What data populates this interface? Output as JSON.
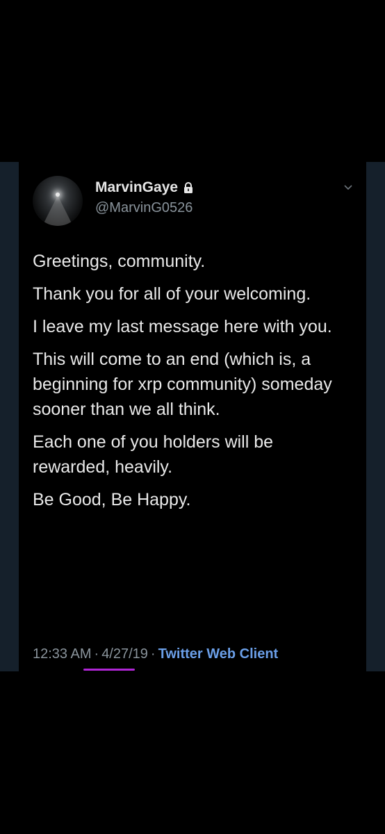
{
  "tweet": {
    "display_name": "MarvinGaye",
    "handle": "@MarvinG0526",
    "paragraphs": [
      "Greetings, community.",
      "Thank you for all of your welcoming.",
      "I leave my last message here with you.",
      "This will come to an end (which is, a beginning for xrp community) someday sooner than we all think.",
      "Each one of you holders will be rewarded, heavily.",
      "Be Good, Be Happy."
    ],
    "time": "12:33 AM",
    "separator": "·",
    "date": "4/27/19",
    "client": "Twitter Web Client"
  },
  "icons": {
    "lock": "lock-icon",
    "caret": "chevron-down-icon",
    "avatar": "lamp-avatar"
  },
  "colors": {
    "background": "#000000",
    "frame": "#15202b",
    "text": "#e9e9e9",
    "muted": "#8a949c",
    "link": "#6b9fe8",
    "annotation": "#b026d6"
  }
}
